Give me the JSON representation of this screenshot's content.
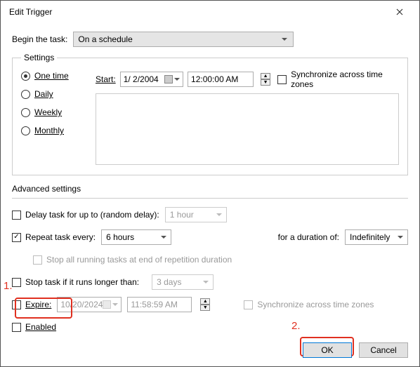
{
  "window": {
    "title": "Edit Trigger"
  },
  "begin": {
    "label": "Begin the task:",
    "value": "On a schedule"
  },
  "settings": {
    "legend": "Settings",
    "radios": {
      "onetime": "One time",
      "daily": "Daily",
      "weekly": "Weekly",
      "monthly": "Monthly"
    },
    "start_label": "Start:",
    "date": "1/ 2/2004",
    "time": "12:00:00 AM",
    "sync_label": "Synchronize across time zones"
  },
  "advanced": {
    "title": "Advanced settings",
    "delay_label": "Delay task for up to (random delay):",
    "delay_value": "1 hour",
    "repeat_label": "Repeat task every:",
    "repeat_value": "6 hours",
    "duration_label": "for a duration of:",
    "duration_value": "Indefinitely",
    "stop_running_label": "Stop all running tasks at end of repetition duration",
    "stop_longer_label": "Stop task if it runs longer than:",
    "stop_longer_value": "3 days",
    "expire_label": "Expire:",
    "expire_date": "10/20/2024",
    "expire_time": "11:58:59 AM",
    "sync_label": "Synchronize across time zones",
    "enabled_label": "Enabled"
  },
  "annotations": {
    "one": "1.",
    "two": "2."
  },
  "buttons": {
    "ok": "OK",
    "cancel": "Cancel"
  }
}
